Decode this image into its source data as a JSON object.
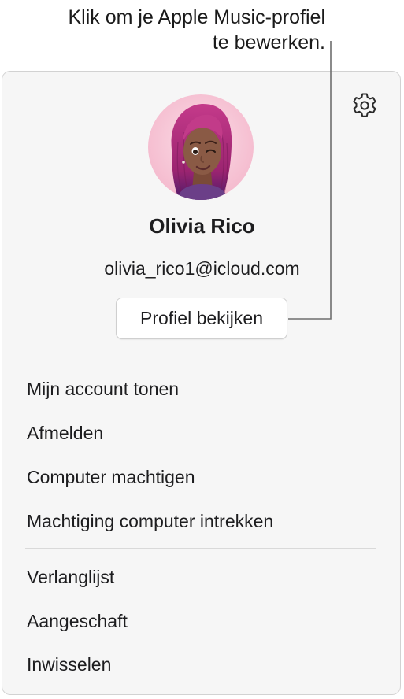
{
  "callout": {
    "line1": "Klik om je Apple Music-profiel",
    "line2": "te bewerken."
  },
  "account": {
    "name": "Olivia Rico",
    "email": "olivia_rico1@icloud.com",
    "view_profile_label": "Profiel bekijken"
  },
  "menu": {
    "group1": [
      {
        "label": "Mijn account tonen"
      },
      {
        "label": "Afmelden"
      },
      {
        "label": "Computer machtigen"
      },
      {
        "label": "Machtiging computer intrekken"
      }
    ],
    "group2": [
      {
        "label": "Verlanglijst"
      },
      {
        "label": "Aangeschaft"
      },
      {
        "label": "Inwisselen"
      }
    ]
  },
  "icons": {
    "settings": "gear-icon",
    "avatar": "memoji-avatar"
  },
  "colors": {
    "panel_bg": "#f6f6f6",
    "avatar_bg": "#f7c6d6",
    "hair": "#b02a78",
    "skin": "#8a5a45"
  }
}
